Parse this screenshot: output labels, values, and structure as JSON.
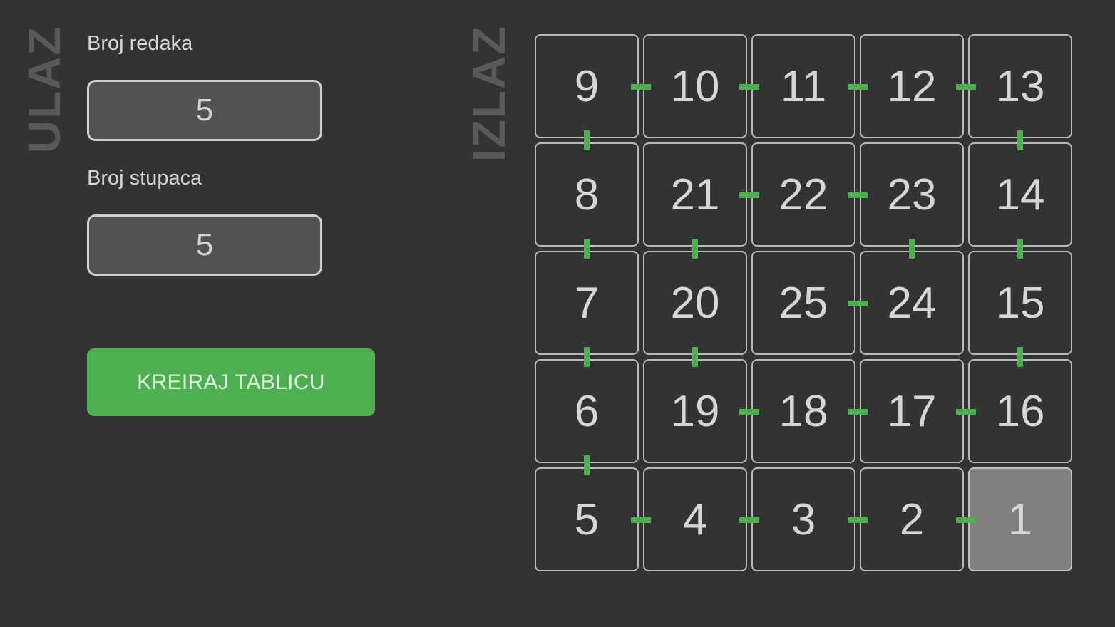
{
  "labels": {
    "input_side": "ULAZ",
    "output_side": "IZLAZ"
  },
  "form": {
    "rows_label": "Broj redaka",
    "rows_value": "5",
    "cols_label": "Broj stupaca",
    "cols_value": "5",
    "create_button": "KREIRAJ TABLICU"
  },
  "grid": {
    "rows": 5,
    "cols": 5,
    "cells": [
      [
        "9",
        "10",
        "11",
        "12",
        "13"
      ],
      [
        "8",
        "21",
        "22",
        "23",
        "14"
      ],
      [
        "7",
        "20",
        "25",
        "24",
        "15"
      ],
      [
        "6",
        "19",
        "18",
        "17",
        "16"
      ],
      [
        "5",
        "4",
        "3",
        "2",
        "1"
      ]
    ],
    "active_cell": "1",
    "connector_color": "#4caf50",
    "active_cell_color": "#808080"
  }
}
